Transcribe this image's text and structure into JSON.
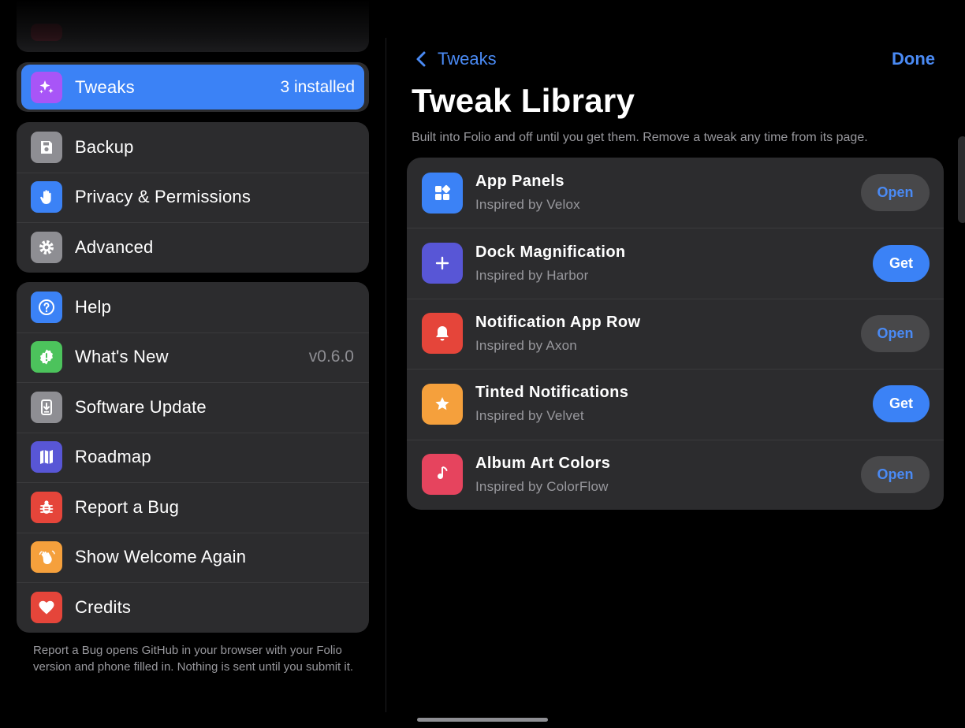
{
  "sidebar": {
    "tweaks": {
      "label": "Tweaks",
      "value": "3 installed"
    },
    "group1": [
      {
        "label": "Backup",
        "icon": "save-icon",
        "color": "#8e8e93"
      },
      {
        "label": "Privacy & Permissions",
        "icon": "hand-icon",
        "color": "#3b82f6"
      },
      {
        "label": "Advanced",
        "icon": "gear-icon",
        "color": "#8e8e93"
      }
    ],
    "group2": [
      {
        "label": "Help",
        "icon": "question-icon",
        "color": "#3b82f6"
      },
      {
        "label": "What's New",
        "value": "v0.6.0",
        "icon": "new-badge-icon",
        "color": "#4cc35c"
      },
      {
        "label": "Software Update",
        "icon": "download-icon",
        "color": "#8e8e93"
      },
      {
        "label": "Roadmap",
        "icon": "map-icon",
        "color": "#5856d6"
      },
      {
        "label": "Report a Bug",
        "icon": "bug-icon",
        "color": "#e5453a"
      },
      {
        "label": "Show Welcome Again",
        "icon": "wave-hand-icon",
        "color": "#f5a03c"
      },
      {
        "label": "Credits",
        "icon": "heart-icon",
        "color": "#e5453a"
      }
    ],
    "footnote": "Report a Bug opens GitHub in your browser with your Folio version and phone filled in. Nothing is sent until you submit it."
  },
  "nav": {
    "back_label": "Tweaks",
    "done_label": "Done"
  },
  "library": {
    "title": "Tweak Library",
    "subtitle": "Built into Folio and off until you get them. Remove a tweak any time from its page.",
    "items": [
      {
        "name": "App Panels",
        "inspired": "Inspired by Velox",
        "action": "Open",
        "icon": "panels-icon",
        "color": "#3b82f6"
      },
      {
        "name": "Dock Magnification",
        "inspired": "Inspired by Harbor",
        "action": "Get",
        "icon": "plus-icon",
        "color": "#5856d6"
      },
      {
        "name": "Notification App Row",
        "inspired": "Inspired by Axon",
        "action": "Open",
        "icon": "bell-icon",
        "color": "#e5453a"
      },
      {
        "name": "Tinted Notifications",
        "inspired": "Inspired by Velvet",
        "action": "Get",
        "icon": "star-icon",
        "color": "#f5a03c"
      },
      {
        "name": "Album Art Colors",
        "inspired": "Inspired by ColorFlow",
        "action": "Open",
        "icon": "music-note-icon",
        "color": "#e6445e"
      }
    ]
  }
}
